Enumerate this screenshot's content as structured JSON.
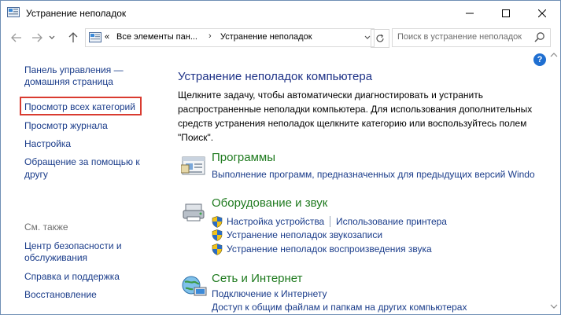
{
  "window": {
    "title": "Устранение неполадок"
  },
  "navigation": {
    "breadcrumb_prefix": "«",
    "breadcrumbs": [
      "Все элементы пан...",
      "Устранение неполадок"
    ],
    "search_placeholder": "Поиск в устранение неполадок"
  },
  "left_pane": {
    "links": [
      "Панель управления —",
      "домашняя страница",
      "Просмотр всех категорий",
      "Просмотр журнала",
      "Настройка",
      "Обращение за помощью к",
      "другу"
    ],
    "see_also_label": "См. также",
    "see_also_links": [
      "Центр безопасности и",
      "обслуживания",
      "Справка и поддержка",
      "Восстановление"
    ]
  },
  "main": {
    "title": "Устранение неполадок компьютера",
    "description": "Щелкните задачу, чтобы автоматически диагностировать и устранить распространенные неполадки компьютера. Для использования дополнительных средств устранения неполадок щелкните категорию или воспользуйтесь полем \"Поиск\".",
    "categories": [
      {
        "title": "Программы",
        "icon": "programs-icon",
        "links": [
          "Выполнение программ, предназначенных для предыдущих версий Windo"
        ]
      },
      {
        "title": "Оборудование и звук",
        "icon": "hardware-sound-icon",
        "links": [
          "Настройка устройства",
          "Использование принтера",
          "Устранение неполадок звукозаписи",
          "Устранение неполадок воспроизведения звука"
        ]
      },
      {
        "title": "Сеть и Интернет",
        "icon": "network-icon",
        "links": [
          "Подключение к Интернету",
          "Доступ к общим файлам и папкам на других компьютерах"
        ]
      }
    ]
  },
  "colors": {
    "link": "#1a3c8a",
    "category_title": "#1e7a1e",
    "heading": "#1e3287",
    "highlight_border": "#d93b30"
  }
}
